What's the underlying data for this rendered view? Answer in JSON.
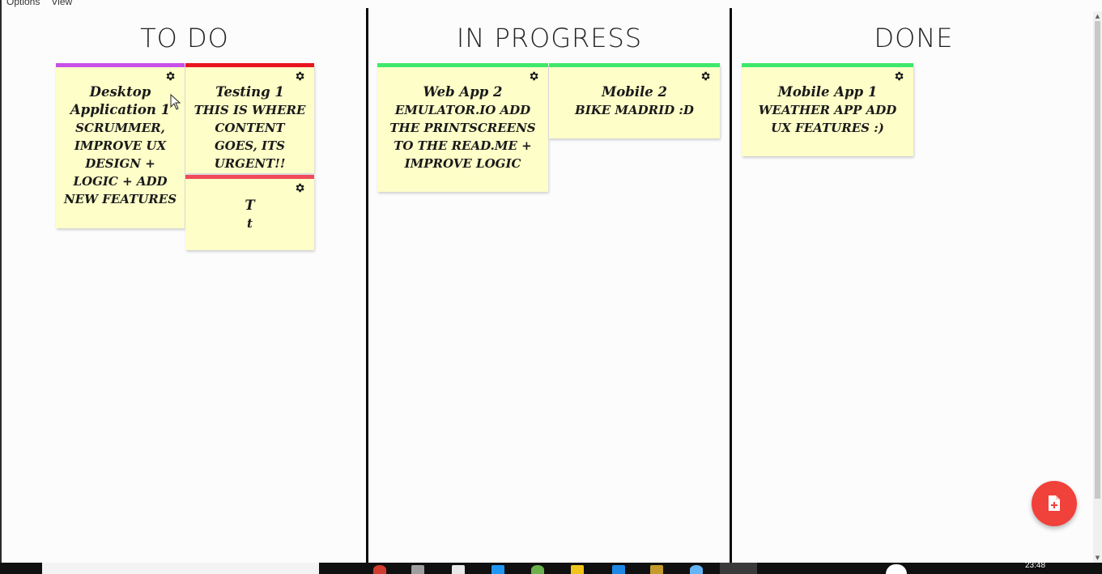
{
  "menu": {
    "items": [
      "Options",
      "View"
    ]
  },
  "columns": [
    {
      "id": "todo",
      "title": "TO DO"
    },
    {
      "id": "inprogress",
      "title": "IN PROGRESS"
    },
    {
      "id": "done",
      "title": "DONE"
    }
  ],
  "notes": {
    "desktop1": {
      "title": "Desktop Application 1",
      "content": "Scrummer, improve UX design + logic + add new features",
      "color": "#c84fe8"
    },
    "testing1": {
      "title": "Testing 1",
      "content": "This is where content goes, its urgent!!",
      "color": "#e8141e"
    },
    "t": {
      "title": "T",
      "content": "t",
      "color": "#ef4a5a"
    },
    "webapp2": {
      "title": "Web App 2",
      "content": "Emulator.io add the printscreens to the read.me + improve logic",
      "color": "#3fe86a"
    },
    "mobile2": {
      "title": "Mobile 2",
      "content": "Bike Madrid :D",
      "color": "#3fe86a"
    },
    "mobileapp1": {
      "title": "Mobile App 1",
      "content": "Weather app add UX features :)",
      "color": "#3fe86a"
    }
  },
  "icons": {
    "settings": "gear-icon",
    "add_note": "add-note-icon"
  },
  "colors": {
    "note_background": "#fdfec8",
    "fab": "#f1413b",
    "divider": "#0a0a0a"
  },
  "taskbar": {
    "time": "23:48"
  }
}
